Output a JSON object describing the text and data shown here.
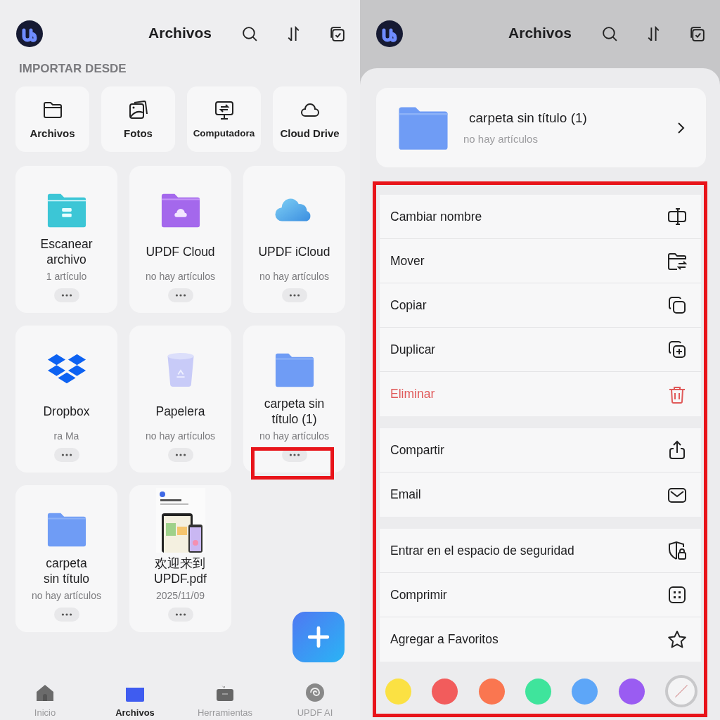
{
  "left": {
    "header": {
      "title": "Archivos"
    },
    "import": {
      "heading": "IMPORTAR DESDE",
      "sources": [
        {
          "label": "Archivos",
          "kind": "folder"
        },
        {
          "label": "Fotos",
          "kind": "photos"
        },
        {
          "label": "Computadora",
          "kind": "computer"
        },
        {
          "label": "Cloud Drive",
          "kind": "cloud"
        }
      ]
    },
    "items": [
      {
        "name": "Escanear\narchivo",
        "detail": "1 artículo",
        "kind": "scan",
        "highlighted": false
      },
      {
        "name": "UPDF Cloud",
        "detail": "no hay artículos",
        "kind": "cloudfolder",
        "highlighted": false
      },
      {
        "name": "UPDF iCloud",
        "detail": "no hay artículos",
        "kind": "icloud",
        "highlighted": false
      },
      {
        "name": "Dropbox",
        "detail": "ra Ma",
        "kind": "dropbox",
        "highlighted": false
      },
      {
        "name": "Papelera",
        "detail": "no hay artículos",
        "kind": "trash",
        "highlighted": false
      },
      {
        "name": "carpeta sin\ntítulo (1)",
        "detail": "no hay artículos",
        "kind": "folder",
        "highlighted": true
      },
      {
        "name": "carpeta\nsin título",
        "detail": "no hay artículos",
        "kind": "folder",
        "highlighted": false
      },
      {
        "name": "欢迎来到\nUPDF.pdf",
        "detail": "2025/11/09",
        "kind": "pdf",
        "highlighted": false
      }
    ],
    "tabs": [
      {
        "label": "Inicio",
        "kind": "home",
        "selected": false
      },
      {
        "label": "Archivos",
        "kind": "files",
        "selected": true
      },
      {
        "label": "Herramientas",
        "kind": "tools",
        "selected": false
      },
      {
        "label": "UPDF AI",
        "kind": "ai",
        "selected": false
      }
    ]
  },
  "right": {
    "header": {
      "title": "Archivos"
    },
    "sheet": {
      "title": "carpeta sin título (1)",
      "detail": "no hay artículos",
      "menu_highlighted": true,
      "groups": [
        [
          {
            "label": "Cambiar nombre",
            "kind": "rename",
            "destructive": false
          },
          {
            "label": "Mover",
            "kind": "move",
            "destructive": false
          },
          {
            "label": "Copiar",
            "kind": "copy",
            "destructive": false
          },
          {
            "label": "Duplicar",
            "kind": "duplicate",
            "destructive": false
          },
          {
            "label": "Eliminar",
            "kind": "delete",
            "destructive": true
          }
        ],
        [
          {
            "label": "Compartir",
            "kind": "share",
            "destructive": false
          },
          {
            "label": "Email",
            "kind": "mail",
            "destructive": false
          }
        ],
        [
          {
            "label": "Entrar en el espacio de seguridad",
            "kind": "secure",
            "destructive": false
          },
          {
            "label": "Comprimir",
            "kind": "compress",
            "destructive": false
          },
          {
            "label": "Agregar a Favoritos",
            "kind": "favorite",
            "destructive": false
          }
        ]
      ],
      "colors": [
        {
          "kind": "color",
          "color": "#fbe143"
        },
        {
          "kind": "color",
          "color": "#f25c5c"
        },
        {
          "kind": "color",
          "color": "#fa7650"
        },
        {
          "kind": "color",
          "color": "#3fe49c"
        },
        {
          "kind": "color",
          "color": "#5da6f8"
        },
        {
          "kind": "color",
          "color": "#9a5cf2"
        },
        {
          "kind": "none"
        }
      ]
    }
  }
}
